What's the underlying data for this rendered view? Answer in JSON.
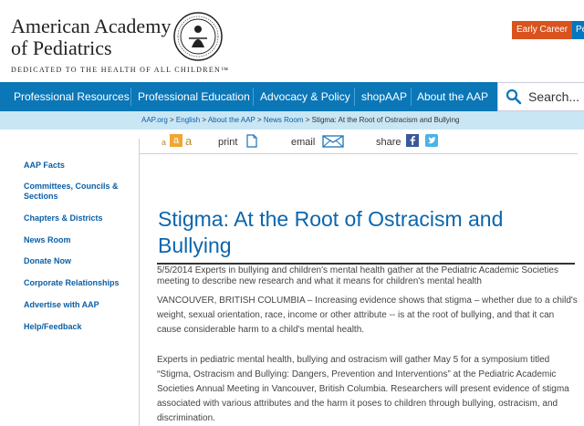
{
  "header": {
    "org_name_line1": "American Academy",
    "org_name_line2": "of Pediatrics",
    "tagline": "DEDICATED TO THE HEALTH OF ALL CHILDREN™",
    "early_career": "Early Career",
    "blue_button": "Pe"
  },
  "nav": {
    "items": [
      {
        "label": "Professional Resources"
      },
      {
        "label": "Professional Education"
      },
      {
        "label": "Advocacy & Policy"
      },
      {
        "label": "shopAAP"
      },
      {
        "label": "About the AAP"
      }
    ],
    "search_placeholder": "Search..."
  },
  "breadcrumb": {
    "items": [
      "AAP.org",
      "English",
      "About the AAP",
      "News Room"
    ],
    "separator": ">",
    "current": "Stigma: At the Root of Ostracism and Bullying"
  },
  "sidebar": {
    "items": [
      "AAP Facts",
      "Committees, Councils & Sections",
      "Chapters & Districts",
      "News Room",
      "Donate Now",
      "Corporate Relationships",
      "Advertise with AAP",
      "Help/Feedback"
    ]
  },
  "tools": {
    "font_small": "a",
    "font_medium": "a",
    "font_large": "a",
    "print": "print",
    "email": "email",
    "share": "share"
  },
  "article": {
    "title": "Stigma: At the Root of Ostracism and Bullying",
    "dek": "5/5/2014 Experts in bullying and children's mental health gather at the Pediatric Academic Societies meeting to describe new research and what it means for children's mental health",
    "paragraphs": [
      "VANCOUVER, BRITISH COLUMBIA  –  Increasing evidence shows that stigma – whether due to a child's weight, sexual orientation, race, income or other attribute -- is at the root of bullying, and that it can cause considerable harm to a child's mental health.",
      "Experts in pediatric mental health, bullying and ostracism will gather May 5 for a symposium titled “Stigma, Ostracism and Bullying: Dangers, Prevention and Interventions” at the Pediatric Academic Societies Annual Meeting in Vancouver, British Columbia. Researchers will present evidence of stigma associated with various attributes and the harm it poses to children through bullying, ostracism, and discrimination."
    ]
  },
  "colors": {
    "nav_blue": "#0b77b7",
    "early_career_orange": "#d9531e",
    "title_blue": "#0b66ad",
    "crumb_bg": "#c9e6f5"
  }
}
